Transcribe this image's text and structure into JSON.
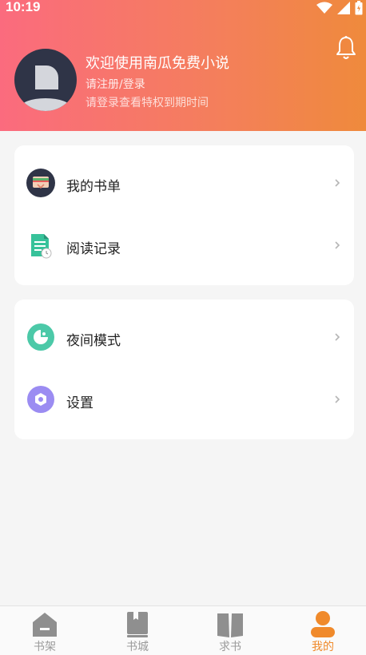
{
  "status_bar": {
    "time": "10:19"
  },
  "header": {
    "welcome": "欢迎使用南瓜免费小说",
    "login_link": "请注册/登录",
    "login_sub": "请登录查看特权到期时间"
  },
  "menu_groups": [
    {
      "items": [
        {
          "label": "我的书单",
          "icon": "booklist-icon"
        },
        {
          "label": "阅读记录",
          "icon": "reading-history-icon"
        }
      ]
    },
    {
      "items": [
        {
          "label": "夜间模式",
          "icon": "night-mode-icon"
        },
        {
          "label": "设置",
          "icon": "settings-icon"
        }
      ]
    }
  ],
  "tabbar": {
    "tabs": [
      {
        "label": "书架",
        "icon": "home-icon"
      },
      {
        "label": "书城",
        "icon": "book-icon"
      },
      {
        "label": "求书",
        "icon": "open-book-icon"
      },
      {
        "label": "我的",
        "icon": "person-icon",
        "active": true
      }
    ]
  },
  "colors": {
    "accent": "#f08a2b",
    "header_start": "#fb6b7e",
    "header_end": "#ef8a3c"
  }
}
